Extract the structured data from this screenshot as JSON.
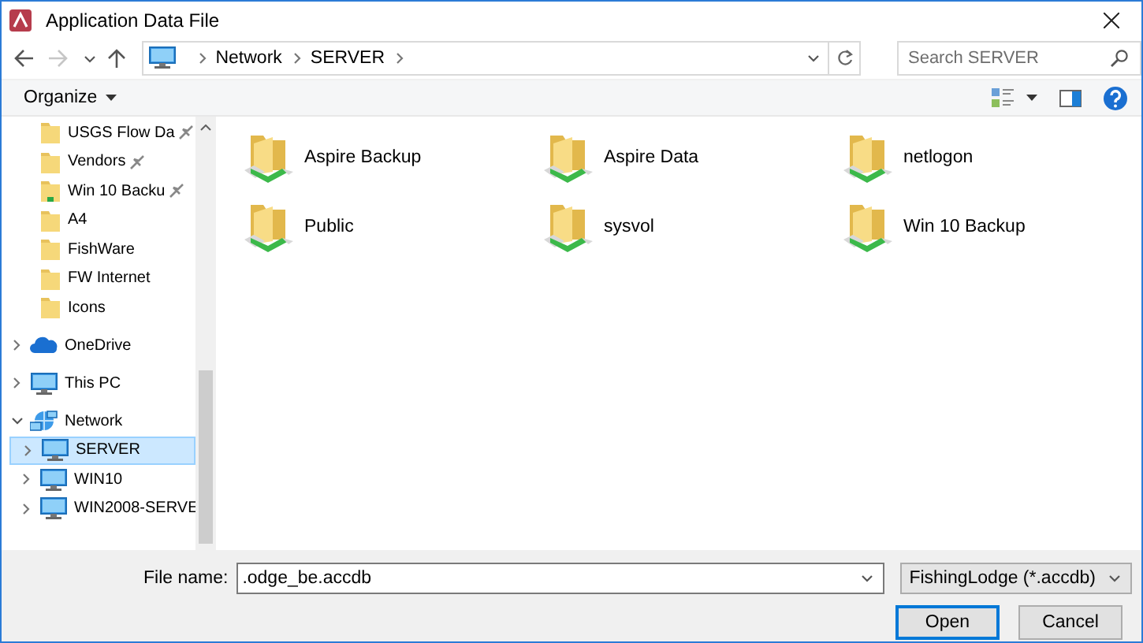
{
  "window": {
    "title": "Application Data File"
  },
  "nav": [
    {
      "kind": "back",
      "disabled": false
    },
    {
      "kind": "forward",
      "disabled": true
    },
    {
      "kind": "recent",
      "disabled": false
    },
    {
      "kind": "up",
      "disabled": false
    }
  ],
  "address": {
    "crumbs": [
      "Network",
      "SERVER"
    ]
  },
  "search": {
    "placeholder": "Search SERVER"
  },
  "toolbar": {
    "organize": "Organize"
  },
  "sidebar": {
    "quick_access": [
      {
        "label": "USGS Flow Da",
        "kind": "folder",
        "pinned": true
      },
      {
        "label": "Vendors",
        "kind": "folder",
        "pinned": true
      },
      {
        "label": "Win 10 Backu",
        "kind": "network-folder",
        "pinned": true
      },
      {
        "label": "A4",
        "kind": "folder",
        "pinned": false
      },
      {
        "label": "FishWare",
        "kind": "folder",
        "pinned": false
      },
      {
        "label": "FW Internet",
        "kind": "folder",
        "pinned": false
      },
      {
        "label": "Icons",
        "kind": "folder",
        "pinned": false
      }
    ],
    "tree": [
      {
        "label": "OneDrive",
        "kind": "cloud",
        "expanded": false,
        "selected": false
      },
      {
        "label": "This PC",
        "kind": "pc",
        "expanded": false,
        "selected": false
      },
      {
        "label": "Network",
        "kind": "network",
        "expanded": true,
        "selected": false,
        "children": [
          {
            "label": "SERVER",
            "kind": "pc",
            "expanded": false,
            "selected": true
          },
          {
            "label": "WIN10",
            "kind": "pc",
            "expanded": false,
            "selected": false
          },
          {
            "label": "WIN2008-SERVE",
            "kind": "pc",
            "expanded": false,
            "selected": false
          }
        ]
      }
    ]
  },
  "content": {
    "items": [
      {
        "label": "Aspire Backup"
      },
      {
        "label": "Aspire Data"
      },
      {
        "label": "netlogon"
      },
      {
        "label": "Public"
      },
      {
        "label": "sysvol"
      },
      {
        "label": "Win 10 Backup"
      }
    ]
  },
  "file_name": {
    "label": "File name:",
    "value": ".odge_be.accdb"
  },
  "file_type": {
    "value": "FishingLodge (*.accdb)"
  },
  "buttons": [
    {
      "label": "Open",
      "default": true
    },
    {
      "label": "Cancel",
      "default": false
    }
  ]
}
